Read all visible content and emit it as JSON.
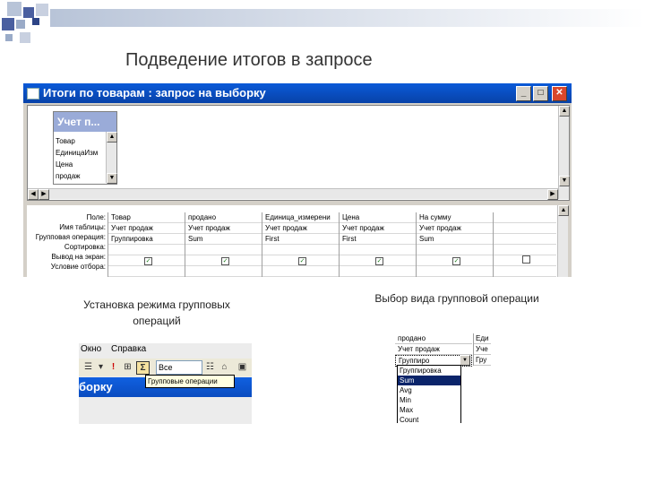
{
  "slide": {
    "title": "Подведение итогов в запросе",
    "caption_left": "Установка режима групповых операций",
    "caption_right": "Выбор вида групповой операции",
    "accent_color": "#0a246a"
  },
  "query_window": {
    "title": "Итоги по товарам : запрос на выборку",
    "controls": {
      "minimize": "_",
      "maximize": "□",
      "close": "✕"
    },
    "table": {
      "name": "Учет п...",
      "fields": [
        "Товар",
        "ЕдиницаИзм",
        "Цена",
        "продаж"
      ]
    },
    "grid": {
      "row_labels": [
        "Поле:",
        "Имя таблицы:",
        "Групповая операция:",
        "Сортировка:",
        "Вывод на экран:",
        "Условие отбора:"
      ],
      "columns": [
        {
          "field": "Товар",
          "table": "Учет продаж",
          "op": "Группировка",
          "show": true
        },
        {
          "field": "продано",
          "table": "Учет продаж",
          "op": "Sum",
          "show": true
        },
        {
          "field": "Единица_измерени",
          "table": "Учет продаж",
          "op": "First",
          "show": true
        },
        {
          "field": "Цена",
          "table": "Учет продаж",
          "op": "First",
          "show": true
        },
        {
          "field": "На сумму",
          "table": "Учет продаж",
          "op": "Sum",
          "show": true
        },
        {
          "field": "",
          "table": "",
          "op": "",
          "show": false
        }
      ]
    }
  },
  "screenshot_toolbar": {
    "menu": [
      "Окно",
      "Справка"
    ],
    "selector_value": "Все",
    "tooltip": "Групповые операции",
    "title_fragment": "борку"
  },
  "screenshot_dropdown": {
    "rows": [
      "продано",
      "Учет продаж",
      "Группиро"
    ],
    "col2": [
      "Еди",
      "Уче",
      "Гру"
    ],
    "options": [
      "Группировка",
      "Sum",
      "Avg",
      "Min",
      "Max",
      "Count"
    ],
    "selected": "Sum"
  }
}
